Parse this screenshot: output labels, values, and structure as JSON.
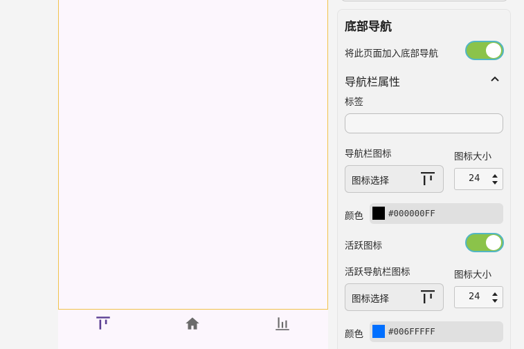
{
  "panel": {
    "section_title": "底部导航",
    "add_to_nav_label": "将此页面加入底部导航",
    "nav_props_title": "导航栏属性",
    "tag_label": "标签",
    "tag_value": "",
    "nav_icon_label": "导航栏图标",
    "icon_size_label": "图标大小",
    "icon_picker_label": "图标选择",
    "icon_size_value": "24",
    "color_label": "颜色",
    "color_value": "#000000FF",
    "active_icon_label": "活跃图标",
    "active_nav_icon_label": "活跃导航栏图标",
    "active_icon_size_label": "图标大小",
    "active_icon_picker_label": "图标选择",
    "active_icon_size_value": "24",
    "active_color_label": "颜色",
    "active_color_value": "#006FFFFF"
  },
  "toggles": {
    "add_to_nav": true,
    "active_icon": true
  },
  "colors": {
    "accent_toggle": "#8bc34a",
    "nav_selected": "#5b3f93",
    "nav_unselected": "#6b6b6b",
    "swatch_1": "#000000",
    "swatch_2": "#006FFF"
  },
  "bottom_nav": {
    "items": [
      {
        "icon": "align-top-icon",
        "selected": true
      },
      {
        "icon": "home-icon",
        "selected": false
      },
      {
        "icon": "bar-chart-icon",
        "selected": false
      }
    ]
  }
}
